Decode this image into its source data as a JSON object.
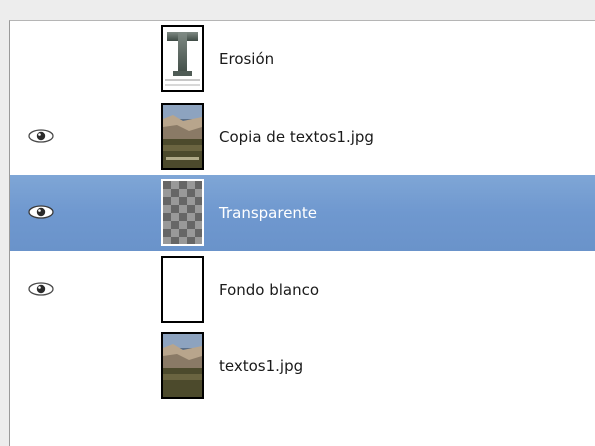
{
  "layers": [
    {
      "name": "Erosión",
      "visible": false,
      "selected": false,
      "thumb": "text-layer-icon"
    },
    {
      "name": "Copia de textos1.jpg",
      "visible": true,
      "selected": false,
      "thumb": "photo-thumbnail"
    },
    {
      "name": "Transparente",
      "visible": true,
      "selected": true,
      "thumb": "transparent-thumbnail"
    },
    {
      "name": "Fondo blanco",
      "visible": true,
      "selected": false,
      "thumb": "white-thumbnail"
    },
    {
      "name": "textos1.jpg",
      "visible": false,
      "selected": false,
      "thumb": "photo-thumbnail"
    }
  ],
  "colors": {
    "selection": "#7aa1d3",
    "panel": "#ffffff"
  }
}
